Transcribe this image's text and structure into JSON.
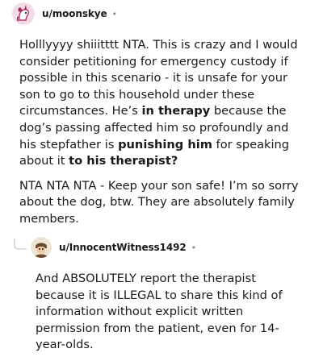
{
  "comments": [
    {
      "username": "u/moonskye",
      "separator": "•",
      "p1": {
        "a": "Holllyyyy shiiitttt NTA. This is crazy and I would consider petitioning for emergency custody if possible in this scenario - it is unsafe for your son to go to this household under these circumstances. He’s ",
        "b1": "in therapy",
        "c": " because the dog’s passing affected him so profoundly and his stepfather is ",
        "b2": "punishing him",
        "d": " for speaking about it ",
        "b3": "to his therapist?"
      },
      "p2": "NTA NTA NTA - Keep your son safe! I’m so sorry about the dog, btw. They are absolutely family members."
    },
    {
      "username": "u/InnocentWitness1492",
      "separator": "•",
      "p1": "And ABSOLUTELY report the therapist because it is ILLEGAL to share this kind of information without explicit written permission from the patient, even for 14-year-olds."
    }
  ],
  "icons": {
    "avatar1": "unicorn-avatar-icon",
    "avatar2": "character-avatar-icon",
    "thread": "reply-thread-curve-icon"
  },
  "colors": {
    "avatar1_bg": "#f2dbe6",
    "avatar1_fg": "#b01a57",
    "avatar2_bg": "#efe3d3",
    "avatar2_fg": "#6b4a2b",
    "thread_line": "#cfd6dc"
  }
}
